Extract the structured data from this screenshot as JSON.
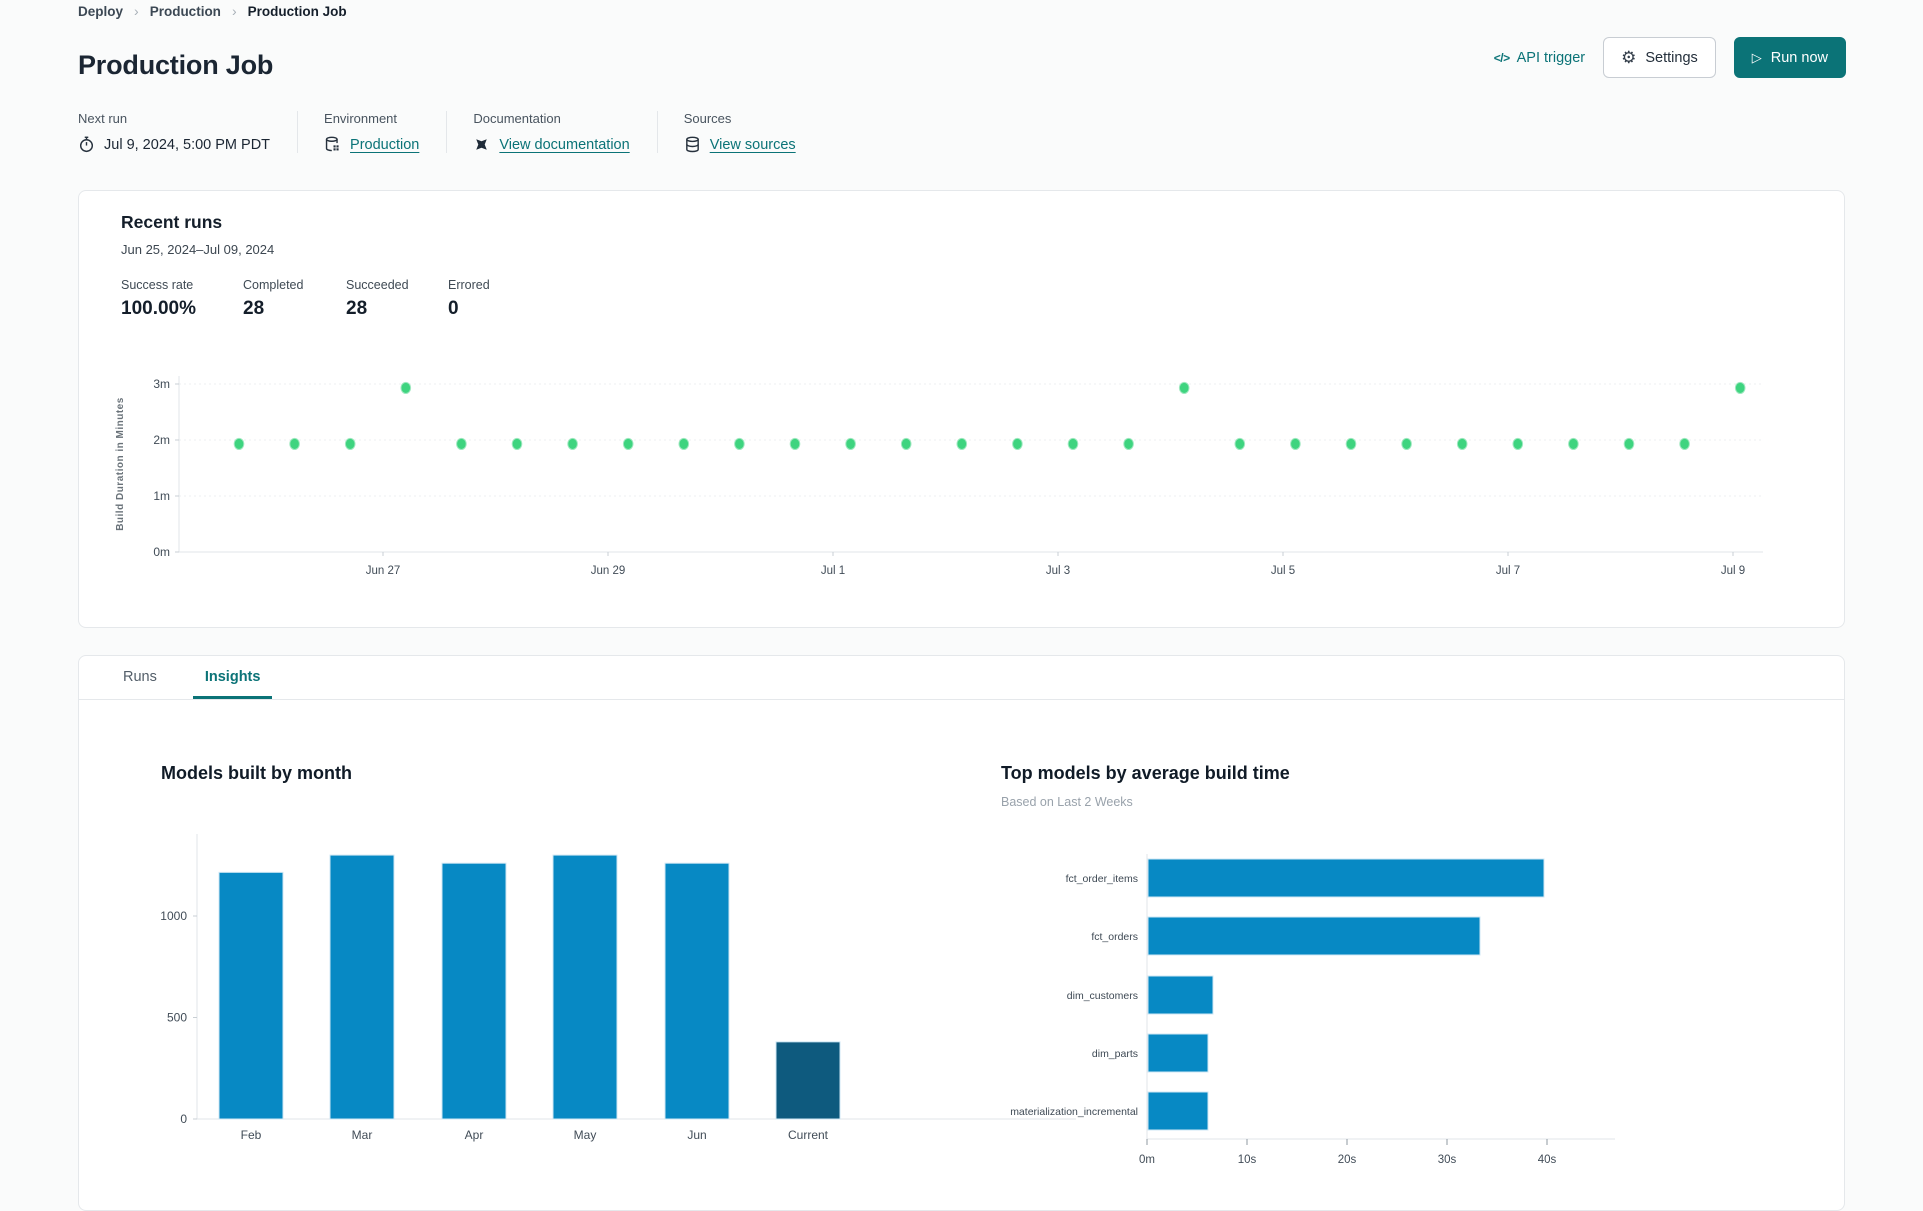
{
  "breadcrumb": {
    "items": [
      "Deploy",
      "Production",
      "Production Job"
    ],
    "separator": "›"
  },
  "page": {
    "title": "Production Job"
  },
  "header_actions": {
    "api_trigger_label": "API trigger",
    "api_trigger_glyph": "</>",
    "settings_label": "Settings",
    "settings_glyph": "⚙",
    "run_now_label": "Run now",
    "run_now_glyph": "▷"
  },
  "info": {
    "next_run": {
      "label": "Next run",
      "value": "Jul 9, 2024, 5:00 PM PDT"
    },
    "environment": {
      "label": "Environment",
      "value": "Production"
    },
    "documentation": {
      "label": "Documentation",
      "value": "View documentation"
    },
    "sources": {
      "label": "Sources",
      "value": "View sources"
    }
  },
  "recent_runs": {
    "title": "Recent runs",
    "date_range": "Jun 25, 2024–Jul 09, 2024",
    "stats": [
      {
        "label": "Success rate",
        "value": "100.00%"
      },
      {
        "label": "Completed",
        "value": "28"
      },
      {
        "label": "Succeeded",
        "value": "28"
      },
      {
        "label": "Errored",
        "value": "0"
      }
    ]
  },
  "tabs": [
    {
      "label": "Runs",
      "active": false
    },
    {
      "label": "Insights",
      "active": true
    }
  ],
  "colors": {
    "teal": "#0b7377",
    "success_dot": "#3ed47f",
    "bar_blue": "#0789c4",
    "bar_dark": "#0e5a7e",
    "axis_line": "#e0e4e8",
    "grid_dotted": "#eceff1",
    "tick_text": "#414c57"
  },
  "chart_data": [
    {
      "id": "build-duration-scatter",
      "type": "scatter",
      "ylabel": "Build Duration in Minutes",
      "yticks": [
        "0m",
        "1m",
        "2m",
        "3m"
      ],
      "ylim_minutes": [
        0,
        3.2
      ],
      "xticks": [
        "Jun 27",
        "Jun 29",
        "Jul 1",
        "Jul 3",
        "Jul 5",
        "Jul 7",
        "Jul 9"
      ],
      "grid": "dotted-horizontal",
      "points": [
        {
          "x": 0,
          "minutes": 1.93
        },
        {
          "x": 1,
          "minutes": 1.93
        },
        {
          "x": 2,
          "minutes": 1.93
        },
        {
          "x": 3,
          "minutes": 2.93
        },
        {
          "x": 4,
          "minutes": 1.93
        },
        {
          "x": 5,
          "minutes": 1.93
        },
        {
          "x": 6,
          "minutes": 1.93
        },
        {
          "x": 7,
          "minutes": 1.93
        },
        {
          "x": 8,
          "minutes": 1.93
        },
        {
          "x": 9,
          "minutes": 1.93
        },
        {
          "x": 10,
          "minutes": 1.93
        },
        {
          "x": 11,
          "minutes": 1.93
        },
        {
          "x": 12,
          "minutes": 1.93
        },
        {
          "x": 13,
          "minutes": 1.93
        },
        {
          "x": 14,
          "minutes": 1.93
        },
        {
          "x": 15,
          "minutes": 1.93
        },
        {
          "x": 16,
          "minutes": 1.93
        },
        {
          "x": 17,
          "minutes": 2.93
        },
        {
          "x": 18,
          "minutes": 1.93
        },
        {
          "x": 19,
          "minutes": 1.93
        },
        {
          "x": 20,
          "minutes": 1.93
        },
        {
          "x": 21,
          "minutes": 1.93
        },
        {
          "x": 22,
          "minutes": 1.93
        },
        {
          "x": 23,
          "minutes": 1.93
        },
        {
          "x": 24,
          "minutes": 1.93
        },
        {
          "x": 25,
          "minutes": 1.93
        },
        {
          "x": 26,
          "minutes": 1.93
        },
        {
          "x": 27,
          "minutes": 2.93
        }
      ]
    },
    {
      "id": "models-built-by-month",
      "type": "bar",
      "title": "Models built by month",
      "categories": [
        "Feb",
        "Mar",
        "Apr",
        "May",
        "Jun",
        "Current"
      ],
      "values": [
        1215,
        1300,
        1260,
        1300,
        1260,
        380
      ],
      "yticks": [
        0,
        500,
        1000
      ],
      "ylim": [
        0,
        1400
      ],
      "highlight_index": 5,
      "legend": "none",
      "grid": "off"
    },
    {
      "id": "top-models-by-average-build-time",
      "type": "bar_horizontal",
      "title": "Top models by average build time",
      "subtitle": "Based on Last 2 Weeks",
      "categories": [
        "fct_order_items",
        "fct_orders",
        "dim_customers",
        "dim_parts",
        "materialization_incremental"
      ],
      "values_seconds": [
        39.6,
        33.2,
        6.5,
        6.0,
        6.0
      ],
      "xticks": [
        {
          "value": 0,
          "label": "0m"
        },
        {
          "value": 10,
          "label": "10s"
        },
        {
          "value": 20,
          "label": "20s"
        },
        {
          "value": 30,
          "label": "30s"
        },
        {
          "value": 40,
          "label": "40s"
        }
      ],
      "xlim_seconds": [
        0,
        44
      ],
      "legend": "none",
      "grid": "off"
    }
  ]
}
